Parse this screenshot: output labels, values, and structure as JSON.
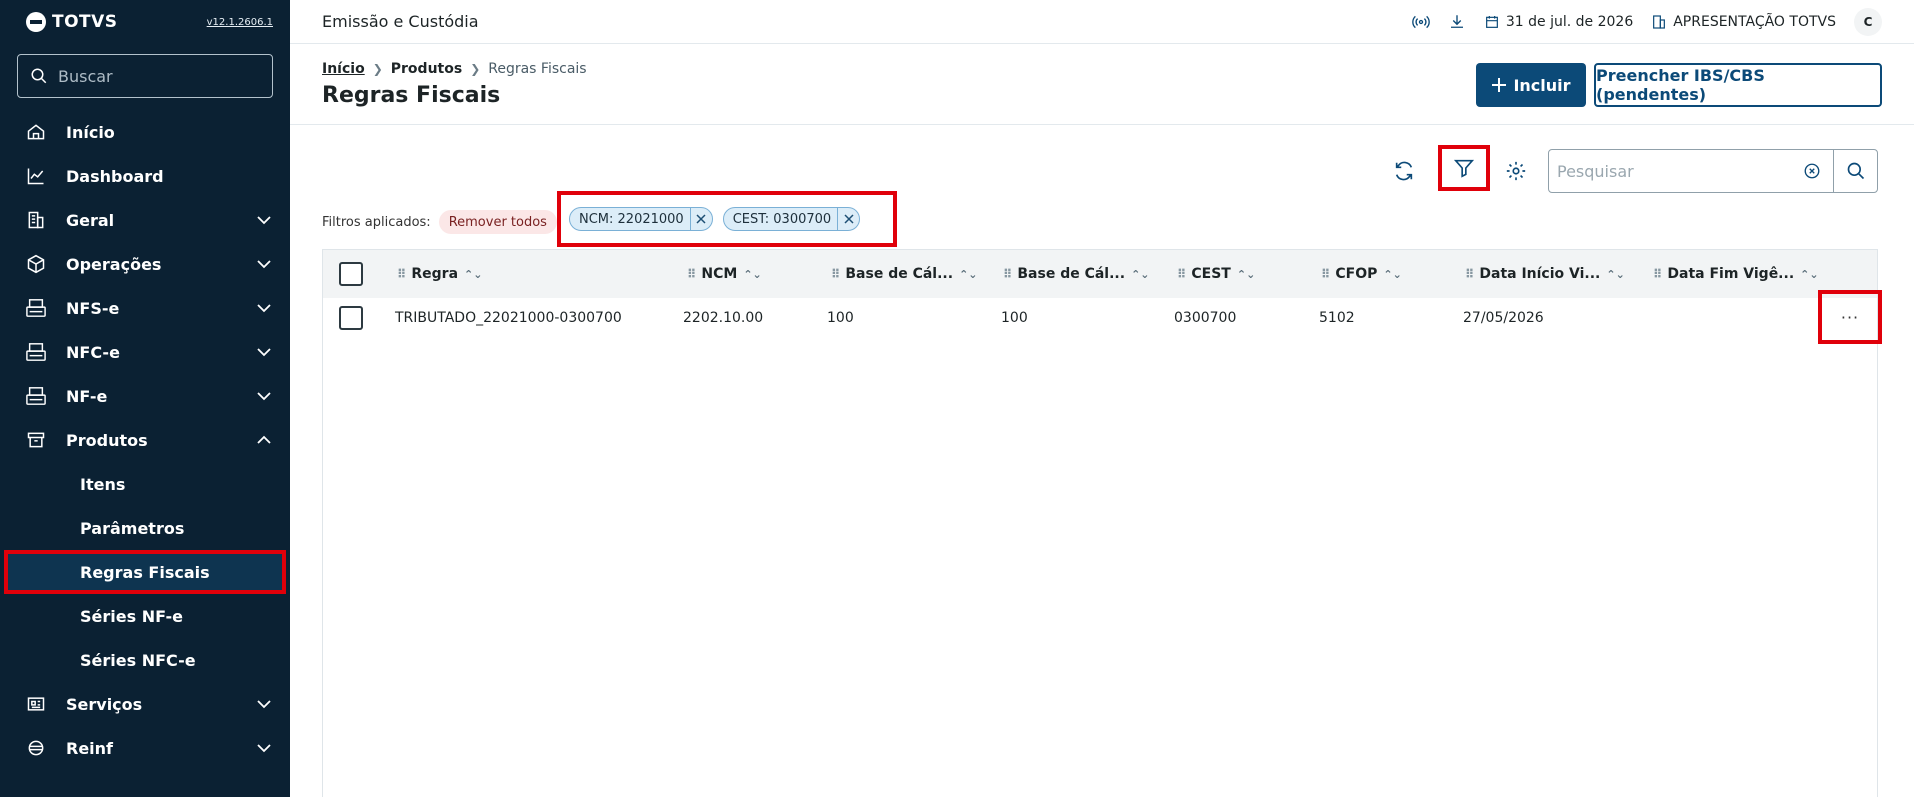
{
  "app": {
    "logo_text": "TOTVS",
    "version": "v12.1.2606.1",
    "module_title": "Emissão e Custódia"
  },
  "sidebar": {
    "search_placeholder": "Buscar",
    "items": [
      {
        "label": "Início",
        "icon": "home-icon"
      },
      {
        "label": "Dashboard",
        "icon": "chart-line-icon"
      },
      {
        "label": "Geral",
        "icon": "building-icon"
      },
      {
        "label": "Operações",
        "icon": "cube-icon"
      },
      {
        "label": "NFS-e",
        "icon": "nfse-icon"
      },
      {
        "label": "NFC-e",
        "icon": "nfce-icon"
      },
      {
        "label": "NF-e",
        "icon": "nfe-icon"
      },
      {
        "label": "Produtos",
        "icon": "box-icon"
      },
      {
        "label": "Serviços",
        "icon": "services-icon"
      },
      {
        "label": "Reinf",
        "icon": "reinf-icon"
      }
    ],
    "produtos_sub": [
      {
        "label": "Itens"
      },
      {
        "label": "Parâmetros"
      },
      {
        "label": "Regras Fiscais"
      },
      {
        "label": "Séries NF-e"
      },
      {
        "label": "Séries NFC-e"
      }
    ]
  },
  "topbar": {
    "date": "31 de jul. de 2026",
    "company": "APRESENTAÇÃO TOTVS",
    "avatar": "C"
  },
  "header": {
    "breadcrumb": [
      "Início",
      "Produtos",
      "Regras Fiscais"
    ],
    "title": "Regras Fiscais",
    "btn_include": "Incluir",
    "btn_fill": "Preencher IBS/CBS (pendentes)"
  },
  "toolbar": {
    "search_placeholder": "Pesquisar"
  },
  "filters": {
    "label": "Filtros aplicados:",
    "remove_all": "Remover todos",
    "chips": [
      "NCM: 22021000",
      "CEST: 0300700"
    ]
  },
  "table": {
    "columns": [
      "Regra",
      "NCM",
      "Base de Cál...",
      "Base de Cál...",
      "CEST",
      "CFOP",
      "Data Início Vi...",
      "Data Fim Vigê..."
    ],
    "rows": [
      [
        "TRIBUTADO_22021000-0300700",
        "2202.10.00",
        "100",
        "100",
        "0300700",
        "5102",
        "27/05/2026",
        ""
      ]
    ],
    "row_actions": "···"
  },
  "colors": {
    "sidebar_bg": "#0b2133",
    "primary": "#0c4a78",
    "highlight": "#e0000a"
  }
}
